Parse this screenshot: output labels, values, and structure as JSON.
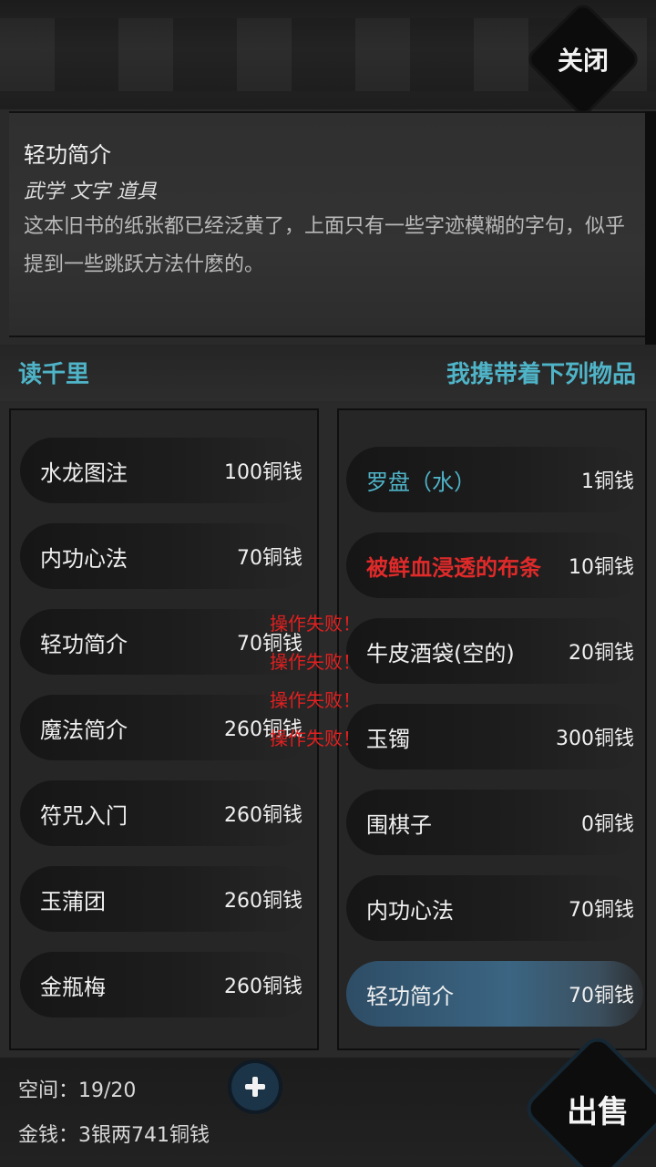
{
  "header": {
    "close_label": "关闭"
  },
  "description": {
    "title": "轻功简介",
    "tags": "武学 文字 道具",
    "body": "这本旧书的纸张都已经泛黄了，上面只有一些字迹模糊的字句，似乎提到一些跳跃方法什麽的。"
  },
  "shop": {
    "name": "读千里",
    "carry_title": "我携带着下列物品"
  },
  "shop_items": [
    {
      "name": "水龙图注",
      "price": "100铜钱"
    },
    {
      "name": "内功心法",
      "price": "70铜钱"
    },
    {
      "name": "轻功简介",
      "price": "70铜钱"
    },
    {
      "name": "魔法简介",
      "price": "260铜钱"
    },
    {
      "name": "符咒入门",
      "price": "260铜钱"
    },
    {
      "name": "玉蒲团",
      "price": "260铜钱"
    },
    {
      "name": "金瓶梅",
      "price": "260铜钱"
    }
  ],
  "inventory_items": [
    {
      "name": "罗盘（水）",
      "price": "1铜钱",
      "color": "#4fb4c8"
    },
    {
      "name": "被鲜血浸透的布条",
      "price": "10铜钱",
      "color": "#e02a2a"
    },
    {
      "name": "牛皮酒袋(空的)",
      "price": "20铜钱"
    },
    {
      "name": "玉镯",
      "price": "300铜钱"
    },
    {
      "name": "围棋子",
      "price": "0铜钱"
    },
    {
      "name": "内功心法",
      "price": "70铜钱"
    },
    {
      "name": "轻功简介",
      "price": "70铜钱",
      "selected": true
    }
  ],
  "toasts": [
    "操作失败！",
    "操作失败！",
    "操作失败！",
    "操作失败！"
  ],
  "footer": {
    "space": "空间：19/20",
    "money": "金钱：3银两741铜钱",
    "sell_label": "出售",
    "add_icon": "plus-icon"
  },
  "colors": {
    "accent": "#4fb4c8",
    "error": "#e02a2a",
    "selected_row": "#3b6582"
  }
}
